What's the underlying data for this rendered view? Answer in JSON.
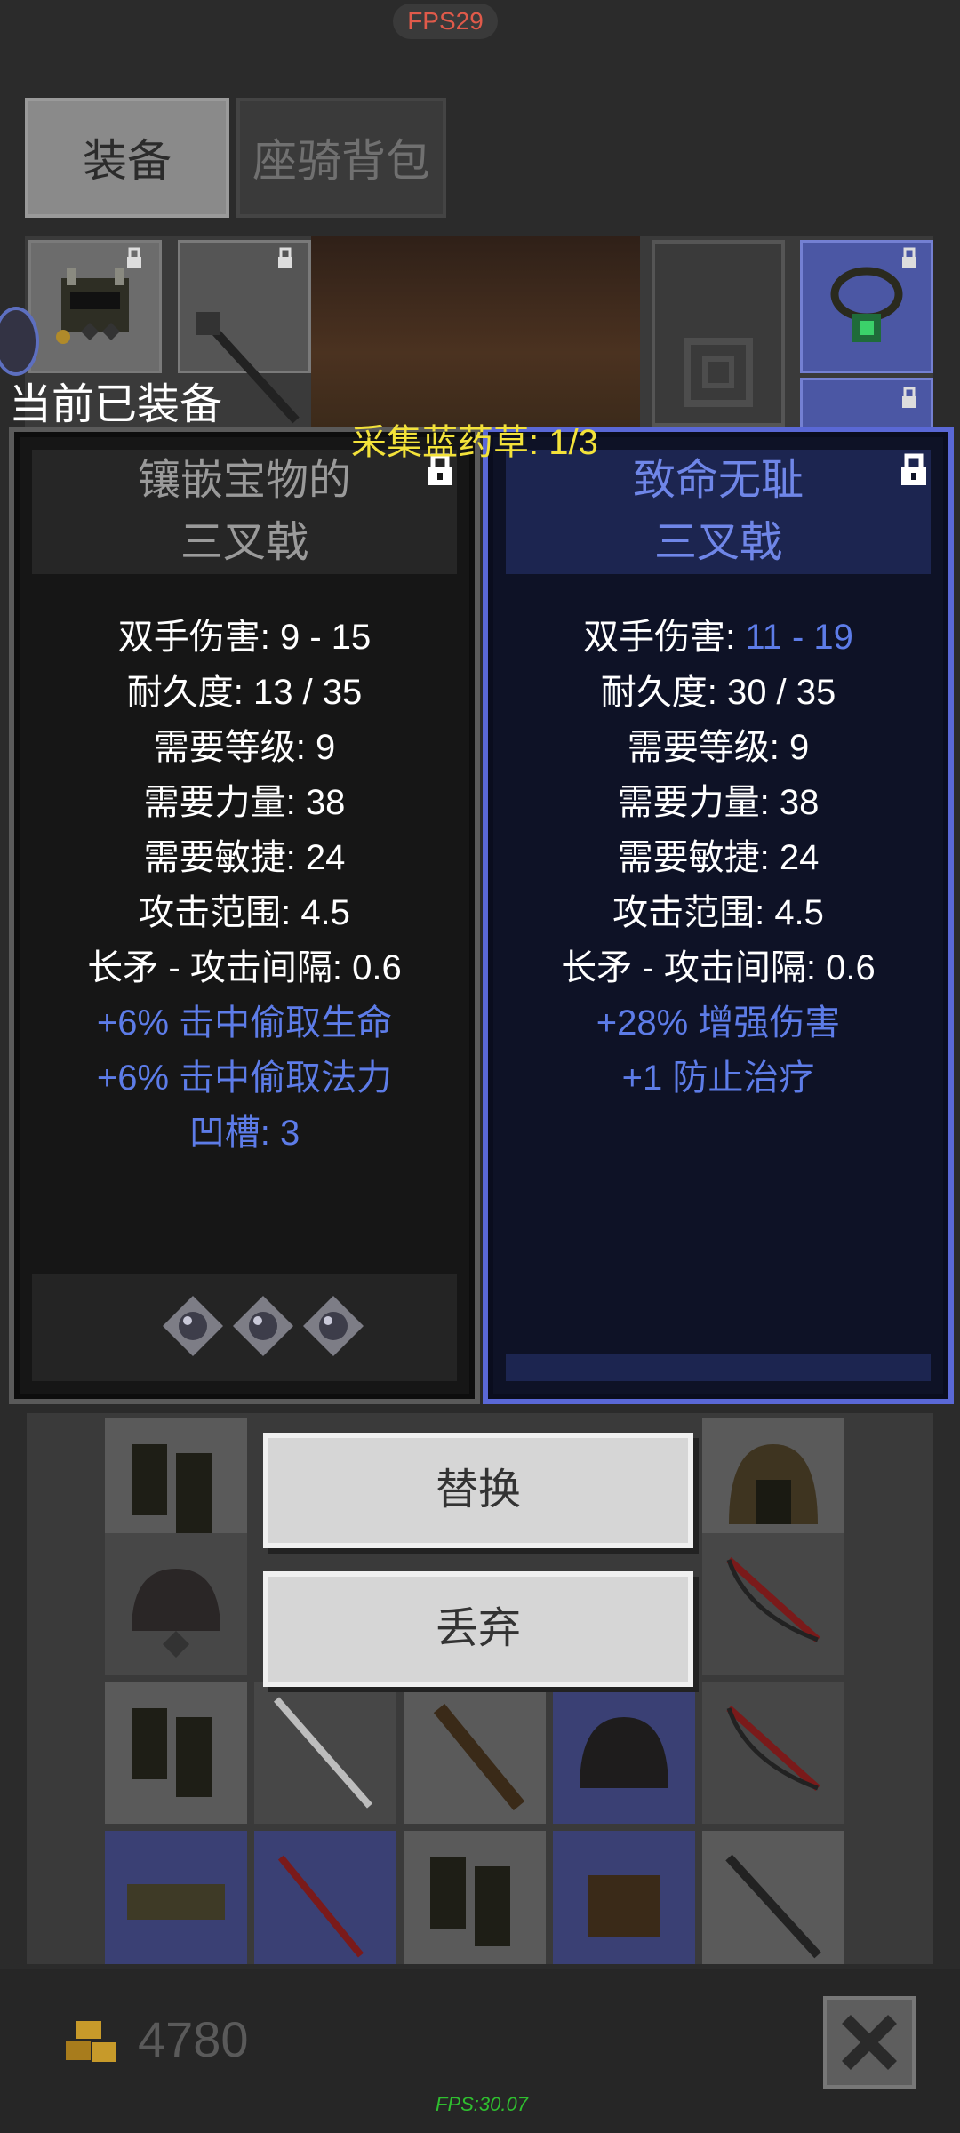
{
  "fps_top": "FPS29",
  "tabs": [
    {
      "label": "装备",
      "active": true
    },
    {
      "label": "座骑背包",
      "active": false
    }
  ],
  "equipped_label": "当前已装备",
  "quest_text": "采集蓝药草: 1/3",
  "current_item": {
    "name_line1": "镶嵌宝物的",
    "name_line2": "三叉戟",
    "stats": [
      {
        "label": "双手伤害: ",
        "value": "9 - 15",
        "value_highlight": false
      },
      {
        "label": "耐久度: ",
        "value": "13 / 35",
        "value_highlight": false
      },
      {
        "label": "需要等级: ",
        "value": "9",
        "value_highlight": false
      },
      {
        "label": "需要力量: ",
        "value": "38",
        "value_highlight": false
      },
      {
        "label": "需要敏捷: ",
        "value": "24",
        "value_highlight": false
      },
      {
        "label": "攻击范围: ",
        "value": "4.5",
        "value_highlight": false
      },
      {
        "label": "长矛 - 攻击间隔: ",
        "value": "0.6",
        "value_highlight": false
      }
    ],
    "affixes": [
      "+6% 击中偷取生命",
      "+6% 击中偷取法力",
      "凹槽: 3"
    ],
    "socket_count": 3
  },
  "new_item": {
    "name_line1": "致命无耻",
    "name_line2": "三叉戟",
    "stats": [
      {
        "label": "双手伤害: ",
        "value": "11 - 19",
        "value_highlight": true
      },
      {
        "label": "耐久度: ",
        "value": "30 / 35",
        "value_highlight": false
      },
      {
        "label": "需要等级: ",
        "value": "9",
        "value_highlight": false
      },
      {
        "label": "需要力量: ",
        "value": "38",
        "value_highlight": false
      },
      {
        "label": "需要敏捷: ",
        "value": "24",
        "value_highlight": false
      },
      {
        "label": "攻击范围: ",
        "value": "4.5",
        "value_highlight": false
      },
      {
        "label": "长矛 - 攻击间隔: ",
        "value": "0.6",
        "value_highlight": false
      }
    ],
    "affixes": [
      "+28% 增强伤害",
      "+1 防止治疗"
    ]
  },
  "buttons": {
    "replace": "替换",
    "discard": "丢弃"
  },
  "gold": "4780",
  "fps_bottom": "FPS:30.07",
  "colors": {
    "magic_blue": "#5d7ce8",
    "quest_yellow": "#f3e23a",
    "fps_red": "#e05a4a",
    "fps_green": "#2fbf2f"
  }
}
